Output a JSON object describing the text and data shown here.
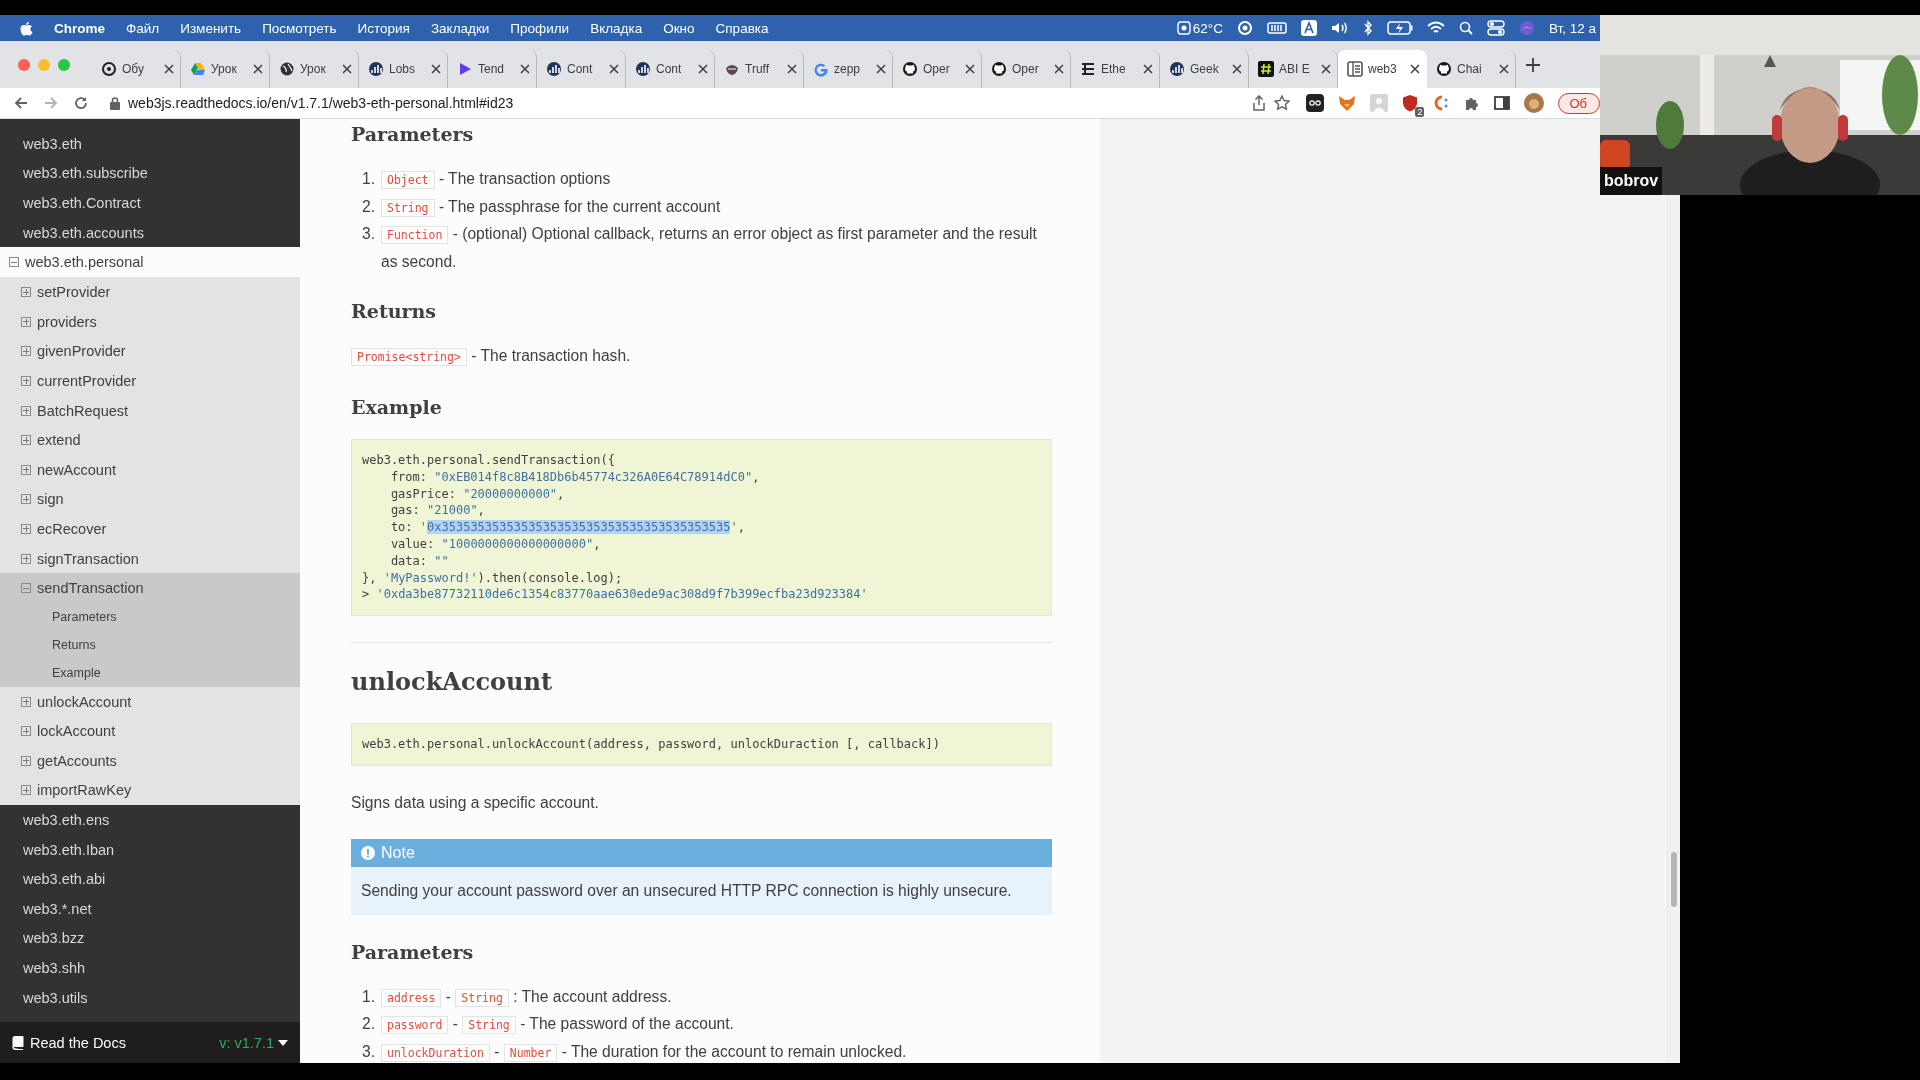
{
  "menu_bar": {
    "app": "Chrome",
    "menus": [
      "Файл",
      "Изменить",
      "Посмотреть",
      "История",
      "Закладки",
      "Профили",
      "Вкладка",
      "Окно",
      "Справка"
    ],
    "temperature": "62°C",
    "clock": "Вт, 12 а"
  },
  "tabs": [
    {
      "title": "Обу",
      "kind": "openai",
      "selected": false
    },
    {
      "title": "Урок",
      "kind": "drive",
      "selected": false
    },
    {
      "title": "Урок",
      "kind": "globe",
      "selected": false
    },
    {
      "title": "Lobs",
      "kind": "chart",
      "selected": false
    },
    {
      "title": "Tend",
      "kind": "tenderly",
      "selected": false
    },
    {
      "title": "Cont",
      "kind": "chart",
      "selected": false
    },
    {
      "title": "Cont",
      "kind": "chart",
      "selected": false
    },
    {
      "title": "Truff",
      "kind": "truffle",
      "selected": false
    },
    {
      "title": "zepp",
      "kind": "google",
      "selected": false
    },
    {
      "title": "Oper",
      "kind": "github",
      "selected": false
    },
    {
      "title": "Oper",
      "kind": "github",
      "selected": false
    },
    {
      "title": "Ethe",
      "kind": "ethereum",
      "selected": false
    },
    {
      "title": "Geek",
      "kind": "chart",
      "selected": false
    },
    {
      "title": "ABI E",
      "kind": "hash",
      "selected": false
    },
    {
      "title": "web3",
      "kind": "docs",
      "selected": true
    },
    {
      "title": "Chai",
      "kind": "github",
      "selected": false
    }
  ],
  "address_bar": {
    "url": "web3js.readthedocs.io/en/v1.7.1/web3-eth-personal.html#id23",
    "extension_badge": "2",
    "update_button": "Об"
  },
  "sidebar": {
    "top_items": [
      "web3.eth",
      "web3.eth.subscribe",
      "web3.eth.Contract",
      "web3.eth.accounts"
    ],
    "current": {
      "label": "web3.eth.personal",
      "expanded": true,
      "children": [
        {
          "label": "setProvider",
          "expanded": false
        },
        {
          "label": "providers",
          "expanded": false
        },
        {
          "label": "givenProvider",
          "expanded": false
        },
        {
          "label": "currentProvider",
          "expanded": false
        },
        {
          "label": "BatchRequest",
          "expanded": false
        },
        {
          "label": "extend",
          "expanded": false
        },
        {
          "label": "newAccount",
          "expanded": false
        },
        {
          "label": "sign",
          "expanded": false
        },
        {
          "label": "ecRecover",
          "expanded": false
        },
        {
          "label": "signTransaction",
          "expanded": false
        },
        {
          "label": "sendTransaction",
          "expanded": true,
          "children": [
            {
              "label": "Parameters"
            },
            {
              "label": "Returns"
            },
            {
              "label": "Example"
            }
          ]
        },
        {
          "label": "unlockAccount",
          "expanded": false
        },
        {
          "label": "lockAccount",
          "expanded": false
        },
        {
          "label": "getAccounts",
          "expanded": false
        },
        {
          "label": "importRawKey",
          "expanded": false
        }
      ]
    },
    "bottom_items": [
      "web3.eth.ens",
      "web3.eth.Iban",
      "web3.eth.abi",
      "web3.*.net",
      "web3.bzz",
      "web3.shh",
      "web3.utils"
    ],
    "footer": {
      "label": "Read the Docs",
      "version": "v: v1.7.1"
    }
  },
  "content": [
    {
      "kind": "heading",
      "text": "Parameters"
    },
    {
      "kind": "list",
      "items": [
        {
          "number": "1.",
          "parts": [
            {
              "kind": "literal",
              "text": "Object"
            },
            {
              "kind": "text",
              "text": " - The transaction options"
            }
          ]
        },
        {
          "number": "2.",
          "parts": [
            {
              "kind": "literal",
              "text": "String"
            },
            {
              "kind": "text",
              "text": " - The passphrase for the current account"
            }
          ]
        },
        {
          "number": "3.",
          "parts": [
            {
              "kind": "literal",
              "text": "Function"
            },
            {
              "kind": "text",
              "text": " - (optional) Optional callback, returns an error object as first parameter and the result as second."
            }
          ]
        }
      ]
    },
    {
      "kind": "heading",
      "text": "Returns"
    },
    {
      "kind": "paragraph",
      "parts": [
        {
          "kind": "literal",
          "text": "Promise<string>"
        },
        {
          "kind": "text",
          "text": " - The transaction hash."
        }
      ]
    },
    {
      "kind": "heading",
      "text": "Example"
    },
    {
      "kind": "code",
      "lines": [
        [
          {
            "kind": "plain",
            "text": "web3.eth.personal.sendTransaction({"
          }
        ],
        [
          {
            "kind": "plain",
            "text": "    from: "
          },
          {
            "kind": "string",
            "text": "\"0xEB014f8c8B418Db6b45774c326A0E64C78914dC0\""
          },
          {
            "kind": "plain",
            "text": ","
          }
        ],
        [
          {
            "kind": "plain",
            "text": "    gasPrice: "
          },
          {
            "kind": "string",
            "text": "\"20000000000\""
          },
          {
            "kind": "plain",
            "text": ","
          }
        ],
        [
          {
            "kind": "plain",
            "text": "    gas: "
          },
          {
            "kind": "string",
            "text": "\"21000\""
          },
          {
            "kind": "plain",
            "text": ","
          }
        ],
        [
          {
            "kind": "plain",
            "text": "    to: "
          },
          {
            "kind": "string",
            "text": "'"
          },
          {
            "kind": "highlight",
            "text": "0x3535353535353535353535353535353535353535"
          },
          {
            "kind": "string",
            "text": "'"
          },
          {
            "kind": "plain",
            "text": ","
          }
        ],
        [
          {
            "kind": "plain",
            "text": "    value: "
          },
          {
            "kind": "string",
            "text": "\"1000000000000000000\""
          },
          {
            "kind": "plain",
            "text": ","
          }
        ],
        [
          {
            "kind": "plain",
            "text": "    data: "
          },
          {
            "kind": "string",
            "text": "\"\""
          }
        ],
        [
          {
            "kind": "plain",
            "text": "}, "
          },
          {
            "kind": "string",
            "text": "'MyPassword!'"
          },
          {
            "kind": "plain",
            "text": ").then(console.log);"
          }
        ],
        [
          {
            "kind": "plain",
            "text": "> "
          },
          {
            "kind": "string",
            "text": "'0xda3be87732110de6c1354c83770aae630ede9ac308d9f7b399ecfba23d923384'"
          }
        ]
      ]
    },
    {
      "kind": "rule"
    },
    {
      "kind": "title",
      "text": "unlockAccount"
    },
    {
      "kind": "code",
      "lines": [
        [
          {
            "kind": "plain",
            "text": "web3.eth.personal.unlockAccount(address, password, unlockDuraction [, callback])"
          }
        ]
      ]
    },
    {
      "kind": "paragraph",
      "parts": [
        {
          "kind": "text",
          "text": "Signs data using a specific account."
        }
      ]
    },
    {
      "kind": "note",
      "title": "Note",
      "text": "Sending your account password over an unsecured HTTP RPC connection is highly unsecure."
    },
    {
      "kind": "heading",
      "text": "Parameters"
    },
    {
      "kind": "list",
      "items": [
        {
          "number": "1.",
          "parts": [
            {
              "kind": "literal",
              "text": "address"
            },
            {
              "kind": "text",
              "text": " - "
            },
            {
              "kind": "literal",
              "text": "String"
            },
            {
              "kind": "text",
              "text": " : The account address."
            }
          ]
        },
        {
          "number": "2.",
          "parts": [
            {
              "kind": "literal",
              "text": "password"
            },
            {
              "kind": "text",
              "text": " - "
            },
            {
              "kind": "literal",
              "text": "String"
            },
            {
              "kind": "text",
              "text": " - The password of the account."
            }
          ]
        },
        {
          "number": "3.",
          "parts": [
            {
              "kind": "literal",
              "text": "unlockDuration"
            },
            {
              "kind": "text",
              "text": " - "
            },
            {
              "kind": "literal",
              "text": "Number"
            },
            {
              "kind": "text",
              "text": " - The duration for the account to remain unlocked."
            }
          ]
        }
      ]
    }
  ],
  "video": {
    "kind": "picture",
    "participant": "bobrov"
  }
}
